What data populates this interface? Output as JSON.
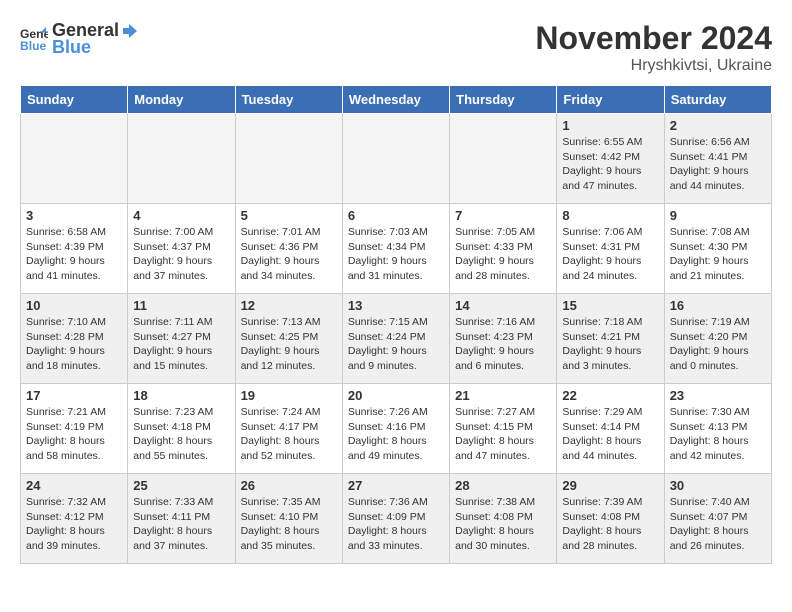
{
  "header": {
    "logo_line1": "General",
    "logo_line2": "Blue",
    "month": "November 2024",
    "location": "Hryshkivtsi, Ukraine"
  },
  "weekdays": [
    "Sunday",
    "Monday",
    "Tuesday",
    "Wednesday",
    "Thursday",
    "Friday",
    "Saturday"
  ],
  "weeks": [
    [
      {
        "day": "",
        "info": "",
        "empty": true
      },
      {
        "day": "",
        "info": "",
        "empty": true
      },
      {
        "day": "",
        "info": "",
        "empty": true
      },
      {
        "day": "",
        "info": "",
        "empty": true
      },
      {
        "day": "",
        "info": "",
        "empty": true
      },
      {
        "day": "1",
        "info": "Sunrise: 6:55 AM\nSunset: 4:42 PM\nDaylight: 9 hours\nand 47 minutes."
      },
      {
        "day": "2",
        "info": "Sunrise: 6:56 AM\nSunset: 4:41 PM\nDaylight: 9 hours\nand 44 minutes."
      }
    ],
    [
      {
        "day": "3",
        "info": "Sunrise: 6:58 AM\nSunset: 4:39 PM\nDaylight: 9 hours\nand 41 minutes."
      },
      {
        "day": "4",
        "info": "Sunrise: 7:00 AM\nSunset: 4:37 PM\nDaylight: 9 hours\nand 37 minutes."
      },
      {
        "day": "5",
        "info": "Sunrise: 7:01 AM\nSunset: 4:36 PM\nDaylight: 9 hours\nand 34 minutes."
      },
      {
        "day": "6",
        "info": "Sunrise: 7:03 AM\nSunset: 4:34 PM\nDaylight: 9 hours\nand 31 minutes."
      },
      {
        "day": "7",
        "info": "Sunrise: 7:05 AM\nSunset: 4:33 PM\nDaylight: 9 hours\nand 28 minutes."
      },
      {
        "day": "8",
        "info": "Sunrise: 7:06 AM\nSunset: 4:31 PM\nDaylight: 9 hours\nand 24 minutes."
      },
      {
        "day": "9",
        "info": "Sunrise: 7:08 AM\nSunset: 4:30 PM\nDaylight: 9 hours\nand 21 minutes."
      }
    ],
    [
      {
        "day": "10",
        "info": "Sunrise: 7:10 AM\nSunset: 4:28 PM\nDaylight: 9 hours\nand 18 minutes."
      },
      {
        "day": "11",
        "info": "Sunrise: 7:11 AM\nSunset: 4:27 PM\nDaylight: 9 hours\nand 15 minutes."
      },
      {
        "day": "12",
        "info": "Sunrise: 7:13 AM\nSunset: 4:25 PM\nDaylight: 9 hours\nand 12 minutes."
      },
      {
        "day": "13",
        "info": "Sunrise: 7:15 AM\nSunset: 4:24 PM\nDaylight: 9 hours\nand 9 minutes."
      },
      {
        "day": "14",
        "info": "Sunrise: 7:16 AM\nSunset: 4:23 PM\nDaylight: 9 hours\nand 6 minutes."
      },
      {
        "day": "15",
        "info": "Sunrise: 7:18 AM\nSunset: 4:21 PM\nDaylight: 9 hours\nand 3 minutes."
      },
      {
        "day": "16",
        "info": "Sunrise: 7:19 AM\nSunset: 4:20 PM\nDaylight: 9 hours\nand 0 minutes."
      }
    ],
    [
      {
        "day": "17",
        "info": "Sunrise: 7:21 AM\nSunset: 4:19 PM\nDaylight: 8 hours\nand 58 minutes."
      },
      {
        "day": "18",
        "info": "Sunrise: 7:23 AM\nSunset: 4:18 PM\nDaylight: 8 hours\nand 55 minutes."
      },
      {
        "day": "19",
        "info": "Sunrise: 7:24 AM\nSunset: 4:17 PM\nDaylight: 8 hours\nand 52 minutes."
      },
      {
        "day": "20",
        "info": "Sunrise: 7:26 AM\nSunset: 4:16 PM\nDaylight: 8 hours\nand 49 minutes."
      },
      {
        "day": "21",
        "info": "Sunrise: 7:27 AM\nSunset: 4:15 PM\nDaylight: 8 hours\nand 47 minutes."
      },
      {
        "day": "22",
        "info": "Sunrise: 7:29 AM\nSunset: 4:14 PM\nDaylight: 8 hours\nand 44 minutes."
      },
      {
        "day": "23",
        "info": "Sunrise: 7:30 AM\nSunset: 4:13 PM\nDaylight: 8 hours\nand 42 minutes."
      }
    ],
    [
      {
        "day": "24",
        "info": "Sunrise: 7:32 AM\nSunset: 4:12 PM\nDaylight: 8 hours\nand 39 minutes."
      },
      {
        "day": "25",
        "info": "Sunrise: 7:33 AM\nSunset: 4:11 PM\nDaylight: 8 hours\nand 37 minutes."
      },
      {
        "day": "26",
        "info": "Sunrise: 7:35 AM\nSunset: 4:10 PM\nDaylight: 8 hours\nand 35 minutes."
      },
      {
        "day": "27",
        "info": "Sunrise: 7:36 AM\nSunset: 4:09 PM\nDaylight: 8 hours\nand 33 minutes."
      },
      {
        "day": "28",
        "info": "Sunrise: 7:38 AM\nSunset: 4:08 PM\nDaylight: 8 hours\nand 30 minutes."
      },
      {
        "day": "29",
        "info": "Sunrise: 7:39 AM\nSunset: 4:08 PM\nDaylight: 8 hours\nand 28 minutes."
      },
      {
        "day": "30",
        "info": "Sunrise: 7:40 AM\nSunset: 4:07 PM\nDaylight: 8 hours\nand 26 minutes."
      }
    ]
  ]
}
